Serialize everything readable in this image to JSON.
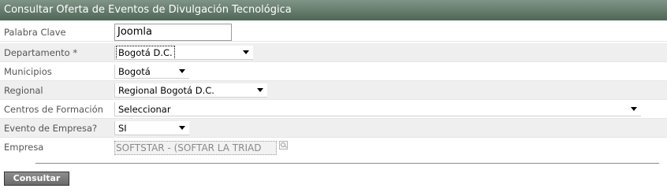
{
  "header": {
    "title": "Consultar Oferta de Eventos de Divulgación Tecnológica"
  },
  "form": {
    "palabra_clave": {
      "label": "Palabra Clave",
      "value": "Joomla"
    },
    "departamento": {
      "label": "Departamento *",
      "value": "Bogotá D.C."
    },
    "municipios": {
      "label": "Municipios",
      "value": "Bogotá"
    },
    "regional": {
      "label": "Regional",
      "value": "Regional Bogotá D.C."
    },
    "centros": {
      "label": "Centros de Formación",
      "value": "Seleccionar"
    },
    "evento_empresa": {
      "label": "Evento de Empresa?",
      "value": "SI"
    },
    "empresa": {
      "label": "Empresa",
      "value": "SOFTSTAR - (SOFTAR LA TRIAD"
    }
  },
  "actions": {
    "consultar_label": "Consultar"
  },
  "icons": {
    "lookup": "search-icon"
  }
}
